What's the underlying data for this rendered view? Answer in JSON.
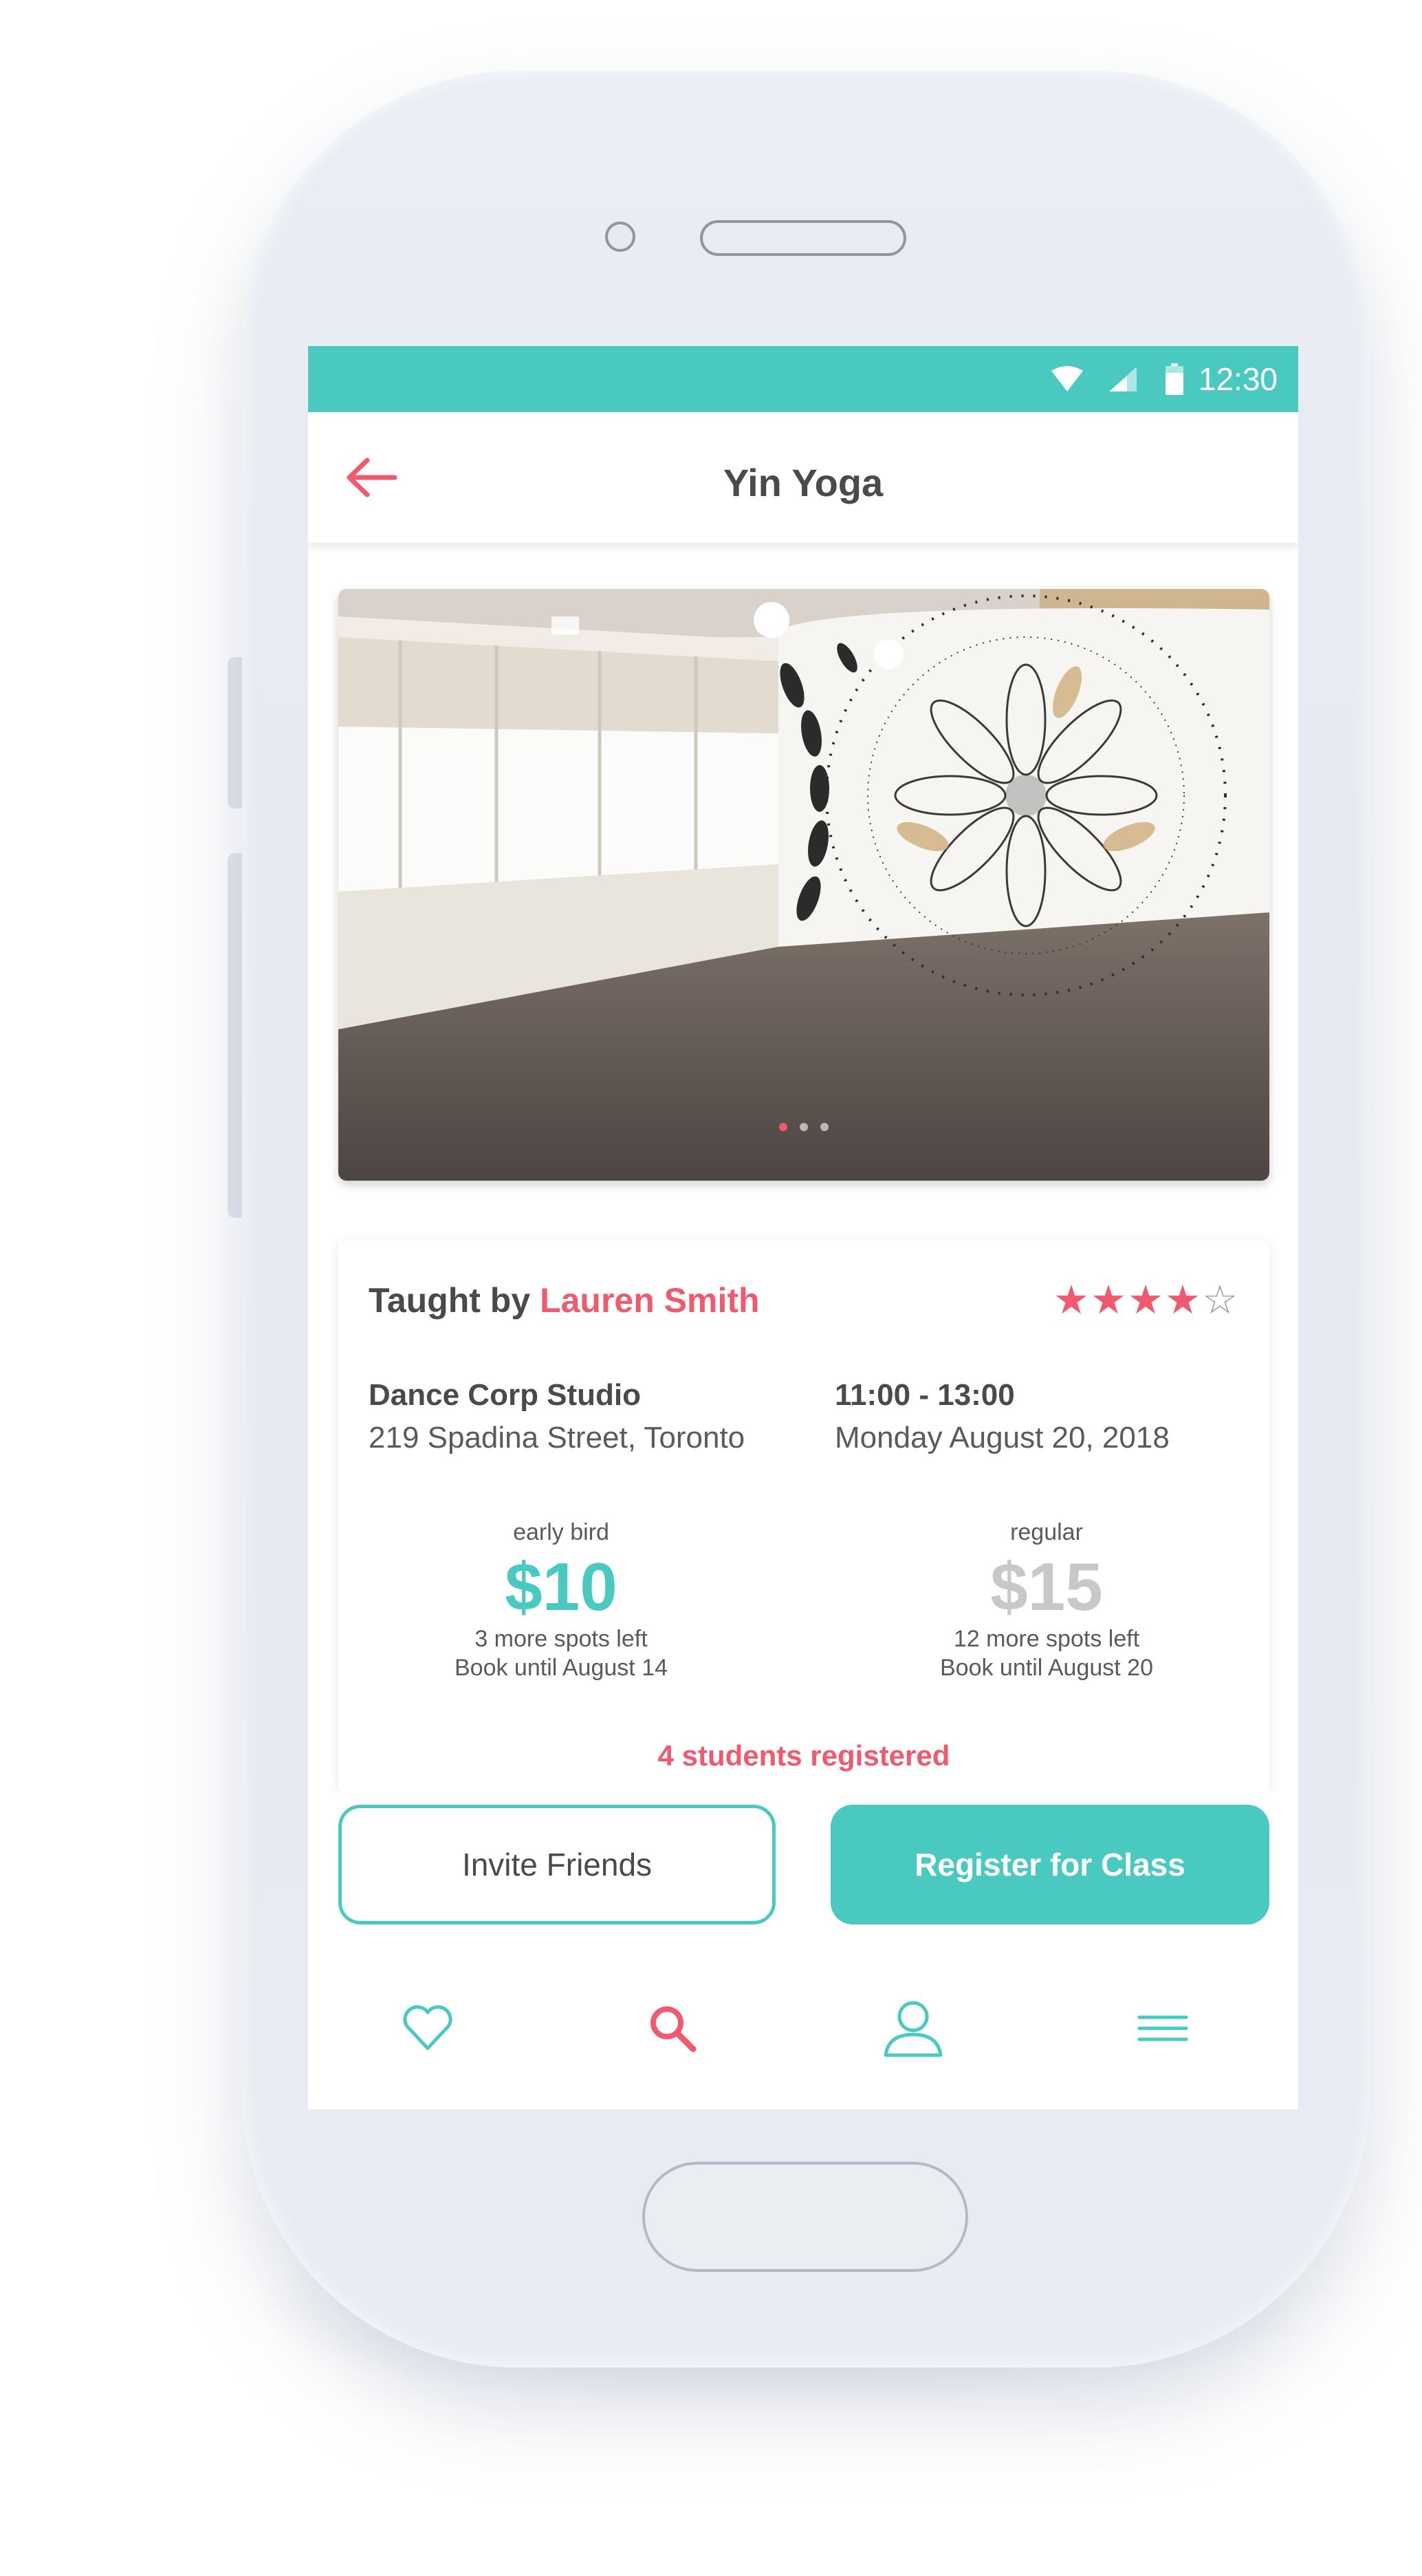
{
  "status_bar": {
    "time": "12:30",
    "icons": [
      "wifi-icon",
      "signal-icon",
      "battery-icon"
    ],
    "color": "#4ac9c1"
  },
  "header": {
    "title": "Yin Yoga",
    "back_icon": "arrow-left-icon"
  },
  "gallery": {
    "image": "studio-photo",
    "page_count": 3,
    "active_page": 1
  },
  "class_info": {
    "taught_by_label": "Taught by",
    "instructor": "Lauren Smith",
    "rating": 4,
    "rating_max": 5,
    "stars_filled": "★★★★",
    "stars_empty": "☆",
    "studio_name": "Dance Corp Studio",
    "studio_address": "219 Spadina Street, Toronto",
    "time": "11:00 - 13:00",
    "date": "Monday August 20, 2018"
  },
  "pricing": {
    "early": {
      "tier": "early bird",
      "price": "$10",
      "spots": "3 more spots left",
      "book_until": "Book until August 14"
    },
    "regular": {
      "tier": "regular",
      "price": "$15",
      "spots": "12 more spots left",
      "book_until": "Book until August 20"
    }
  },
  "registered": "4 students registered",
  "actions": {
    "invite_label": "Invite Friends",
    "register_label": "Register for Class"
  },
  "nav": {
    "items": [
      "heart-icon",
      "search-icon",
      "profile-icon",
      "menu-icon"
    ],
    "active": "search-icon"
  },
  "colors": {
    "accent": "#4ac9c1",
    "highlight": "#f05a6e",
    "text": "#4a4a4a"
  }
}
